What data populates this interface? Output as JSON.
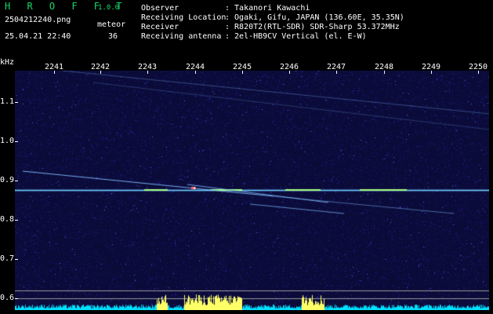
{
  "header": {
    "app_title": "H R O F F T",
    "version": "1.0.0",
    "filename": "2504212240.png",
    "mode_label": "meteor",
    "datetime": "25.04.21 22:40",
    "count": "36",
    "fields": [
      {
        "label": "Observer",
        "value": ": Takanori Kawachi"
      },
      {
        "label": "Receiving Location",
        "value": ": Ogaki, Gifu, JAPAN (136.60E, 35.35N)"
      },
      {
        "label": "Receiver",
        "value": ": R820T2(RTL-SDR) SDR-Sharp 53.372MHz"
      },
      {
        "label": "Receiving antenna",
        "value": ": 2el-HB9CV Vertical (el. E-W)"
      }
    ]
  },
  "plot": {
    "y_unit": "kHz",
    "x_ticks": [
      "2241",
      "2242",
      "2243",
      "2244",
      "2245",
      "2246",
      "2247",
      "2248",
      "2249",
      "2250"
    ],
    "y_ticks": [
      "1.1",
      "1.0",
      "0.9",
      "0.8",
      "0.7",
      "0.6"
    ],
    "colors": {
      "background": "#0b0b3a",
      "noise": "#1a1a7a",
      "carrier": "#5fd0ff",
      "trace": "#7fbfff",
      "hot": "#ffff66",
      "cyan": "#00e0ff"
    }
  }
}
